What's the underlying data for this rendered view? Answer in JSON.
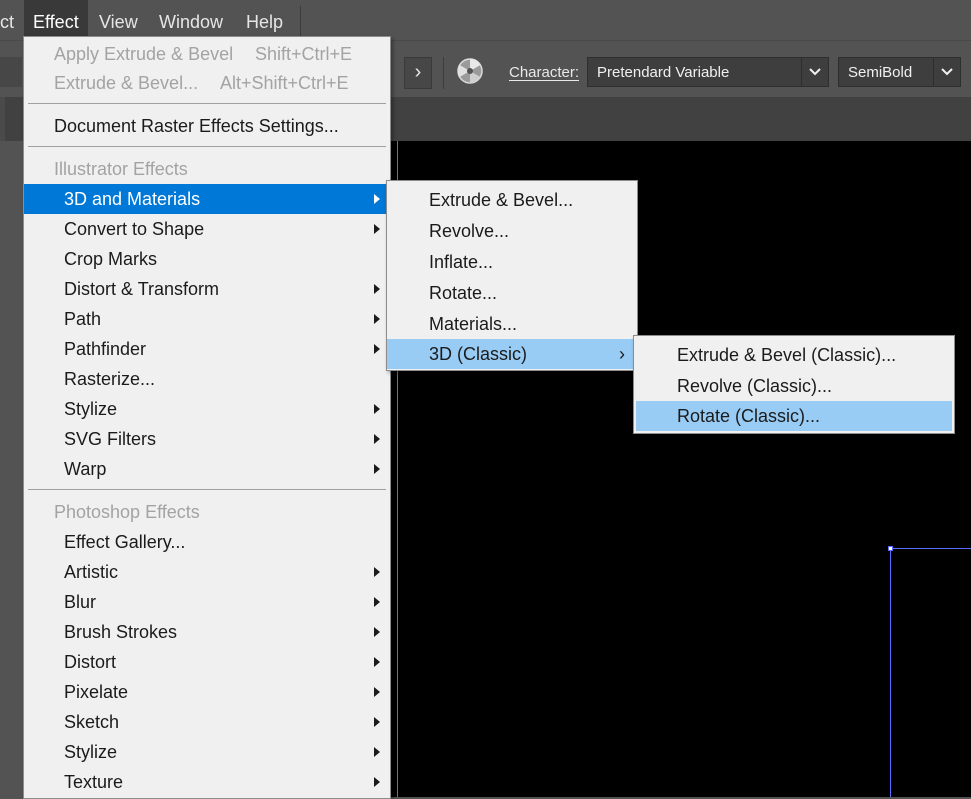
{
  "menubar": {
    "items": [
      "ct",
      "Effect",
      "View",
      "Window",
      "Help"
    ]
  },
  "control_bar": {
    "next_glyph": "›",
    "character_label": "Character:",
    "font_family": "Pretendard Variable",
    "font_style": "SemiBold",
    "icons": [
      "chevron-right-icon",
      "recolor-artwork-icon",
      "chevron-down-icon"
    ]
  },
  "effect_menu": {
    "apply_last": {
      "label": "Apply Extrude & Bevel",
      "shortcut": "Shift+Ctrl+E"
    },
    "last_effect": {
      "label": "Extrude & Bevel...",
      "shortcut": "Alt+Shift+Ctrl+E"
    },
    "document_raster": "Document Raster Effects Settings...",
    "illustrator_header": "Illustrator Effects",
    "illustrator_items": [
      "3D and Materials",
      "Convert to Shape",
      "Crop Marks",
      "Distort & Transform",
      "Path",
      "Pathfinder",
      "Rasterize...",
      "Stylize",
      "SVG Filters",
      "Warp"
    ],
    "photoshop_header": "Photoshop Effects",
    "photoshop_items": [
      "Effect Gallery...",
      "Artistic",
      "Blur",
      "Brush Strokes",
      "Distort",
      "Pixelate",
      "Sketch",
      "Stylize",
      "Texture"
    ]
  },
  "materials_submenu": {
    "items": [
      "Extrude & Bevel...",
      "Revolve...",
      "Inflate...",
      "Rotate...",
      "Materials...",
      "3D (Classic)"
    ],
    "submenu_glyph": "›"
  },
  "classic_submenu": {
    "items": [
      "Extrude & Bevel (Classic)...",
      "Revolve (Classic)...",
      "Rotate (Classic)..."
    ]
  },
  "colors": {
    "highlight_blue": "#0078d7",
    "highlight_light": "#99ccf5",
    "menu_bg": "#f0f0f0",
    "ui_dark": "#535353",
    "canvas": "#000000"
  }
}
